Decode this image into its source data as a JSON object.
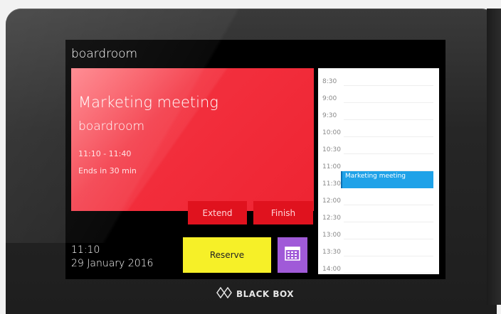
{
  "room": {
    "title": "boardroom"
  },
  "meeting": {
    "title": "Marketing meeting",
    "room": "boardroom",
    "time": "11:10 - 11:40",
    "remaining": "Ends in 30 min",
    "color": "#ee2432"
  },
  "actions": {
    "extend_label": "Extend",
    "finish_label": "Finish",
    "reserve_label": "Reserve",
    "calendar_icon": "calendar-icon",
    "reserve_color": "#f6f028",
    "calendar_color": "#a05ad8"
  },
  "clock": {
    "time": "11:10",
    "date": "29 January 2016"
  },
  "schedule": {
    "slots": [
      "8:30",
      "9:00",
      "9:30",
      "10:00",
      "10:30",
      "11:00",
      "11:30",
      "12:00",
      "12:30",
      "13:00",
      "13:30",
      "14:00"
    ],
    "event": {
      "title": "Marketing meeting",
      "start": "11:10",
      "end": "11:40",
      "color": "#1fa2e8"
    }
  },
  "brand": {
    "name": "BLACK BOX",
    "icon": "blackbox-diamond-logo"
  }
}
